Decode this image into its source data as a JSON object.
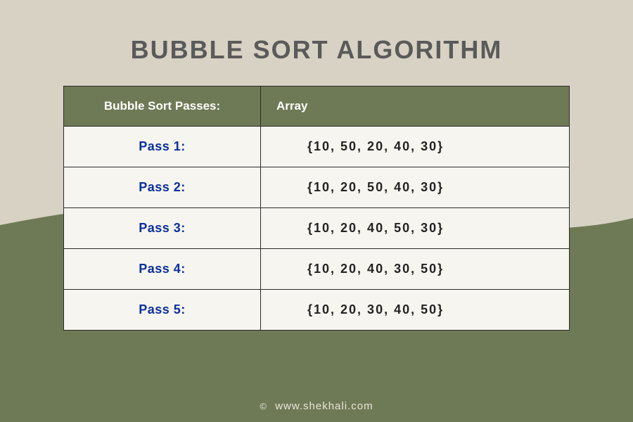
{
  "title": "BUBBLE SORT ALGORITHM",
  "table": {
    "header": {
      "col1": "Bubble Sort Passes:",
      "col2": "Array"
    },
    "rows": [
      {
        "pass": "Pass 1:",
        "array": "{10, 50, 20, 40, 30}"
      },
      {
        "pass": "Pass 2:",
        "array": "{10, 20, 50, 40, 30}"
      },
      {
        "pass": "Pass 3:",
        "array": "{10, 20, 40, 50, 30}"
      },
      {
        "pass": "Pass 4:",
        "array": "{10, 20, 40, 30, 50}"
      },
      {
        "pass": "Pass 5:",
        "array": "{10, 20, 30, 40, 50}"
      }
    ]
  },
  "footer": {
    "copyright_symbol": "©",
    "site": "www.shekhali.com"
  },
  "colors": {
    "bg_top": "#d8d2c4",
    "bg_bottom": "#6e7a55",
    "header_bg": "#6e7a55",
    "cell_bg": "#f6f5f0",
    "pass_text": "#0a2f9e",
    "title_text": "#5a5a5a"
  }
}
